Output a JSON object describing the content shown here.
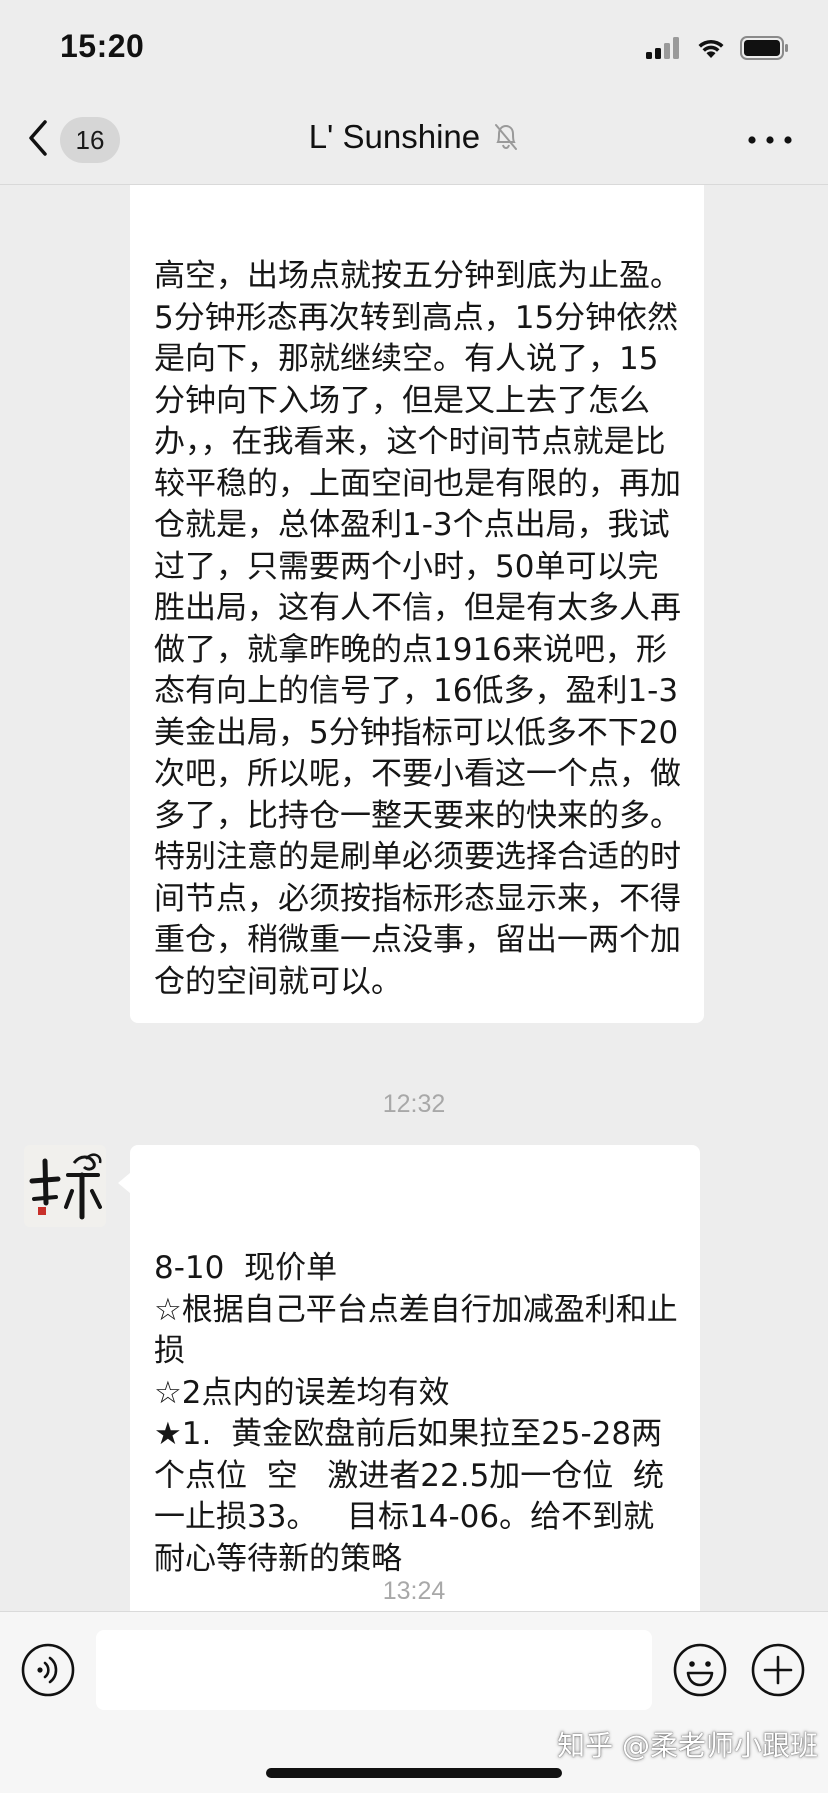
{
  "status_bar": {
    "time": "15:20",
    "icons": [
      "cellular-signal-icon",
      "wifi-icon",
      "battery-icon"
    ]
  },
  "nav": {
    "back_icon": "chevron-left-icon",
    "unread_count": "16",
    "title": "L' Sunshine",
    "muted_icon": "bell-slash-icon",
    "more_icon": "more-dots-icon"
  },
  "messages": [
    {
      "type": "text",
      "side": "left",
      "text": "高空，出场点就按五分钟到底为止盈。5分钟形态再次转到高点，15分钟依然是向下，那就继续空。有人说了，15分钟向下入场了，但是又上去了怎么办，，在我看来，这个时间节点就是比较平稳的，上面空间也是有限的，再加仓就是，总体盈利1-3个点出局，我试过了，只需要两个小时，50单可以完胜出局，这有人不信，但是有太多人再做了，就拿昨晚的点1916来说吧，形态有向上的信号了，16低多，盈利1-3美金出局，5分钟指标可以低多不下20次吧，所以呢，不要小看这一个点，做多了，比持仓一整天要来的快来的多。\n特别注意的是刷单必须要选择合适的时间节点，必须按指标形态显示来，不得重仓，稍微重一点没事，留出一两个加仓的空间就可以。"
    },
    {
      "type": "timestamp",
      "text": "12:32"
    },
    {
      "type": "text",
      "side": "left",
      "text": "8-10  现价单\n☆根据自己平台点差自行加减盈利和止损\n☆2点内的误差均有效\n★1.  黄金欧盘前后如果拉至25-28两个点位  空   激进者22.5加一仓位  统一止损33。   目标14-06。给不到就耐心等待新的策略"
    },
    {
      "type": "timestamp",
      "text": "13:24"
    }
  ],
  "input_bar": {
    "voice_icon": "voice-icon",
    "input_value": "",
    "emoji_icon": "emoji-icon",
    "plus_icon": "plus-icon"
  },
  "watermark": "知乎 @柔老师小跟班",
  "colors": {
    "background": "#ededed",
    "bubble": "#ffffff",
    "timestamp": "#a8a8a8",
    "input_bar": "#f6f6f6"
  }
}
